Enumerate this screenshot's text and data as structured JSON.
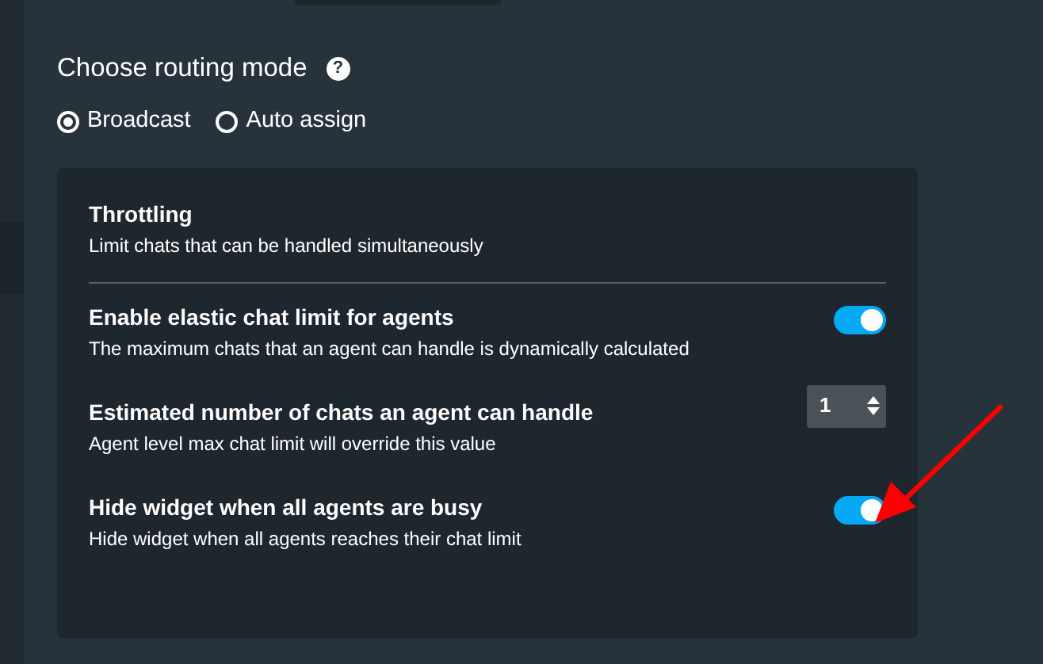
{
  "routing": {
    "label": "Choose routing mode",
    "help": "?",
    "options": [
      {
        "label": "Broadcast",
        "selected": true
      },
      {
        "label": "Auto assign",
        "selected": false
      }
    ]
  },
  "throttling": {
    "title": "Throttling",
    "description": "Limit chats that can be handled simultaneously"
  },
  "settings": [
    {
      "kind": "toggle",
      "title": "Enable elastic chat limit for agents",
      "description": "The maximum chats that an agent can handle is dynamically calculated",
      "on": true
    },
    {
      "kind": "number",
      "title": "Estimated number of chats an agent can handle",
      "description": "Agent level max chat limit will override this value",
      "value": "1"
    },
    {
      "kind": "toggle",
      "title": "Hide widget when all agents are busy",
      "description": "Hide widget when all agents reaches their chat limit",
      "on": true
    }
  ]
}
